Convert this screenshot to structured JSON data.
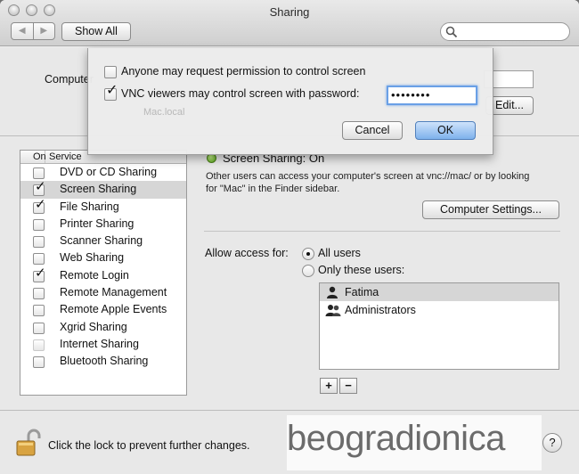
{
  "window": {
    "title": "Sharing"
  },
  "toolbar": {
    "back": "◀",
    "forward": "▶",
    "show_all": "Show All",
    "search_placeholder": ""
  },
  "computer": {
    "label": "Computer",
    "edit_label": "Edit..."
  },
  "services": {
    "header_on": "On",
    "header_service": "Service",
    "items": [
      {
        "label": "DVD or CD Sharing",
        "checked": false,
        "selected": false,
        "dim": false
      },
      {
        "label": "Screen Sharing",
        "checked": true,
        "selected": true,
        "dim": false
      },
      {
        "label": "File Sharing",
        "checked": true,
        "selected": false,
        "dim": false
      },
      {
        "label": "Printer Sharing",
        "checked": false,
        "selected": false,
        "dim": false
      },
      {
        "label": "Scanner Sharing",
        "checked": false,
        "selected": false,
        "dim": false
      },
      {
        "label": "Web Sharing",
        "checked": false,
        "selected": false,
        "dim": false
      },
      {
        "label": "Remote Login",
        "checked": true,
        "selected": false,
        "dim": false
      },
      {
        "label": "Remote Management",
        "checked": false,
        "selected": false,
        "dim": false
      },
      {
        "label": "Remote Apple Events",
        "checked": false,
        "selected": false,
        "dim": false
      },
      {
        "label": "Xgrid Sharing",
        "checked": false,
        "selected": false,
        "dim": false
      },
      {
        "label": "Internet Sharing",
        "checked": false,
        "selected": false,
        "dim": true
      },
      {
        "label": "Bluetooth Sharing",
        "checked": false,
        "selected": false,
        "dim": false
      }
    ]
  },
  "status": {
    "title": "Screen Sharing: On",
    "description": "Other users can access your computer's screen at vnc://mac/ or by looking for \"Mac\" in the Finder sidebar.",
    "computer_settings": "Computer Settings...",
    "status_color": "#5fb31f"
  },
  "access": {
    "label": "Allow access for:",
    "all_users": "All users",
    "only_these": "Only these users:",
    "selected": "all",
    "users": [
      {
        "name": "Fatima",
        "icon": "user-icon",
        "selected": true
      },
      {
        "name": "Administrators",
        "icon": "group-icon",
        "selected": false
      }
    ],
    "add": "+",
    "remove": "−"
  },
  "footer": {
    "lock_text": "Click the lock to prevent further changes.",
    "help": "?"
  },
  "sheet": {
    "opt1": "Anyone may request permission to control screen",
    "opt1_checked": false,
    "opt2": "VNC viewers may control screen with password:",
    "opt2_checked": true,
    "password": "••••••••",
    "ghost_text": "Mac.local",
    "cancel": "Cancel",
    "ok": "OK"
  },
  "watermark": "beogradionica"
}
